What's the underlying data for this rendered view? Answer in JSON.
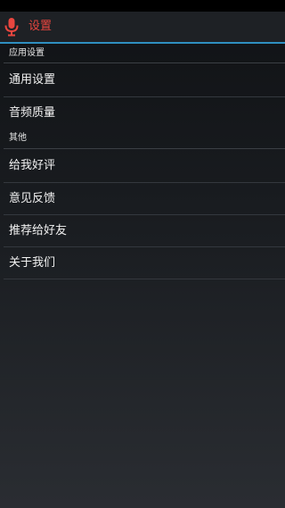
{
  "action_bar": {
    "title": "设置",
    "icon": "microphone-icon",
    "accent_color": "#e8463f",
    "divider_color": "#2f8fc0"
  },
  "sections": [
    {
      "header": "应用设置",
      "items": [
        {
          "label": "通用设置"
        },
        {
          "label": "音频质量"
        }
      ]
    },
    {
      "header": "其他",
      "items": [
        {
          "label": "给我好评"
        },
        {
          "label": "意见反馈"
        },
        {
          "label": "推荐给好友"
        },
        {
          "label": "关于我们"
        }
      ]
    }
  ]
}
